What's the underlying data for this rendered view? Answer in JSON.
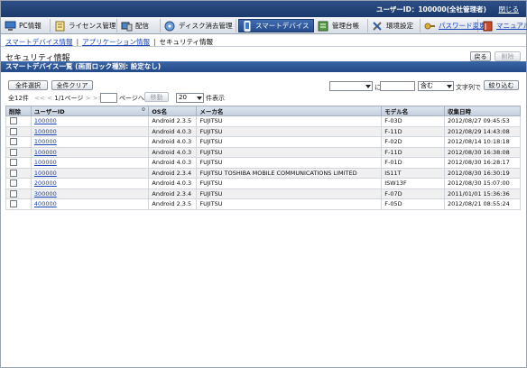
{
  "header": {
    "user": "ユーザーID：100000(全社管理者)",
    "logout": "閉じる"
  },
  "menu": {
    "items": [
      {
        "label": "PC情報",
        "icon": "pc-icon"
      },
      {
        "label": "ライセンス管理",
        "icon": "license-icon"
      },
      {
        "label": "配信",
        "icon": "delivery-icon"
      },
      {
        "label": "ディスク消去管理",
        "icon": "disk-erase-icon"
      },
      {
        "label": "スマートデバイス",
        "icon": "smart-device-icon"
      },
      {
        "label": "管理台帳",
        "icon": "ledger-icon"
      },
      {
        "label": "環境設定",
        "icon": "settings-icon"
      },
      {
        "label": "パスワード変更",
        "icon": "key-icon"
      },
      {
        "label": "マニュアル",
        "icon": "manual-icon"
      }
    ]
  },
  "breadcrumb": {
    "item1": "スマートデバイス情報",
    "item2": "アプリケーション情報",
    "current": "セキュリティ情報",
    "sep": "|"
  },
  "page": {
    "title": "セキュリティ情報",
    "back": "戻る",
    "delete": "削除"
  },
  "section": {
    "title": "スマートデバイス一覧 (画面ロック種別: 設定なし)"
  },
  "toolbar": {
    "select_all": "全件選択",
    "clear_all": "全件クリア",
    "filter_field_value": "",
    "filter_sep": "に",
    "filter_op": "含む",
    "filter_suffix": "文字列で",
    "filter_button": "絞り込む"
  },
  "pager": {
    "total": "全12件",
    "first": "<<",
    "prev": "<",
    "page_info": "1/1ページ",
    "next": ">",
    "last": ">>",
    "goto_label": "ページへ",
    "goto_button": "移動",
    "per_page": "20",
    "per_page_suffix": "件表示"
  },
  "table": {
    "headers": {
      "delete": "削除",
      "user_id": "ユーザーID",
      "os": "OS名",
      "maker": "メーカ名",
      "model": "モデル名",
      "collected": "収集日時"
    },
    "sort_icon": "≎",
    "rows": [
      {
        "user_id": "100000",
        "os": "Android 2.3.5",
        "maker": "FUJITSU",
        "model": "F-03D",
        "collected": "2012/08/27 09:45:53"
      },
      {
        "user_id": "100000",
        "os": "Android 4.0.3",
        "maker": "FUJITSU",
        "model": "F-11D",
        "collected": "2012/08/29 14:43:08"
      },
      {
        "user_id": "100000",
        "os": "Android 4.0.3",
        "maker": "FUJITSU",
        "model": "F-02D",
        "collected": "2012/08/14 10:18:18"
      },
      {
        "user_id": "100000",
        "os": "Android 4.0.3",
        "maker": "FUJITSU",
        "model": "F-11D",
        "collected": "2012/08/30 16:38:08"
      },
      {
        "user_id": "100000",
        "os": "Android 4.0.3",
        "maker": "FUJITSU",
        "model": "F-01D",
        "collected": "2012/08/30 16:28:17"
      },
      {
        "user_id": "100000",
        "os": "Android 2.3.4",
        "maker": "FUJITSU TOSHIBA MOBILE COMMUNICATIONS LIMITED",
        "model": "IS11T",
        "collected": "2012/08/30 16:30:19"
      },
      {
        "user_id": "200000",
        "os": "Android 4.0.3",
        "maker": "FUJITSU",
        "model": "ISW13F",
        "collected": "2012/08/30 15:07:00"
      },
      {
        "user_id": "300000",
        "os": "Android 2.3.4",
        "maker": "FUJITSU",
        "model": "F-07D",
        "collected": "2011/01/01 15:36:36"
      },
      {
        "user_id": "400000",
        "os": "Android 2.3.5",
        "maker": "FUJITSU",
        "model": "F-05D",
        "collected": "2012/08/21 08:55:24"
      }
    ]
  }
}
